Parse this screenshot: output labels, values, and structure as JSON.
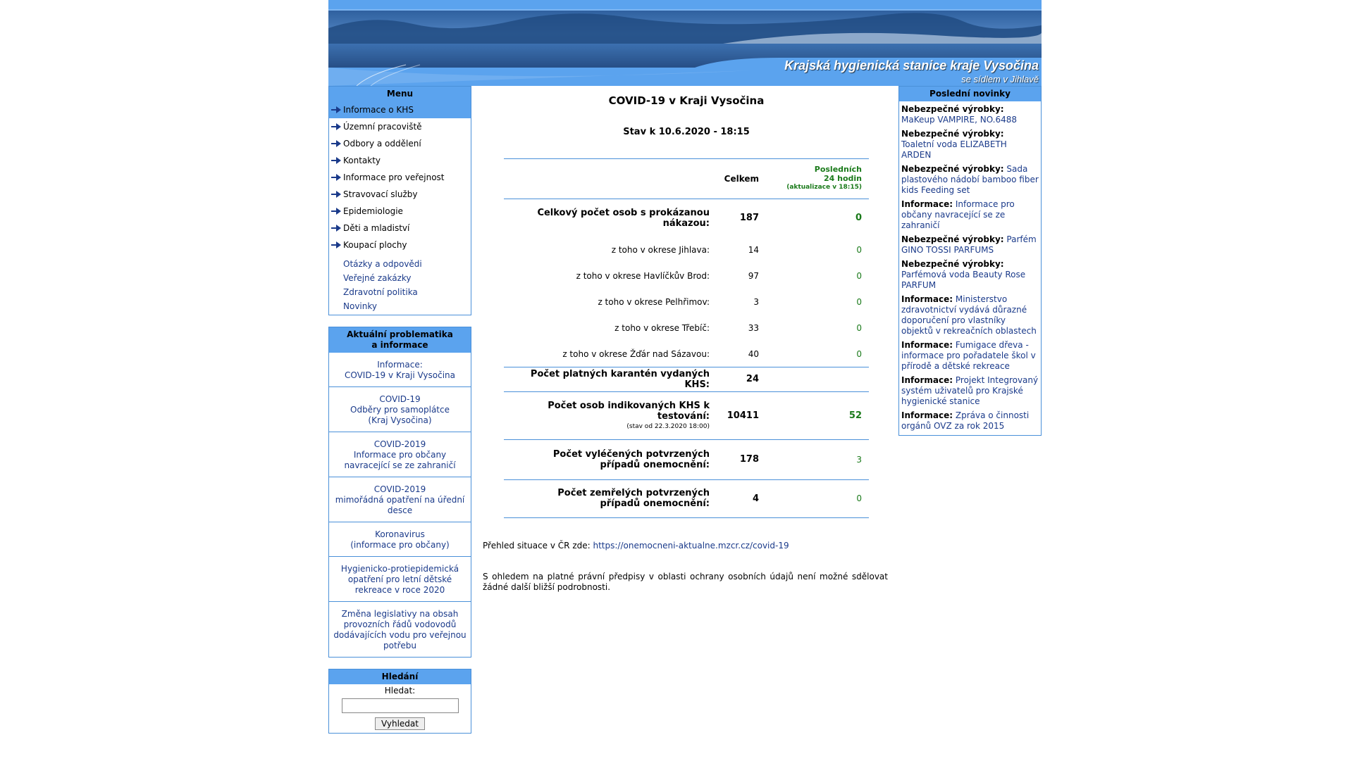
{
  "header": {
    "title": "Krajská hygienická stanice kraje Vysočina",
    "subtitle": "se sídlem v Jihlavě"
  },
  "menu": {
    "heading": "Menu",
    "items": [
      {
        "label": "Informace o KHS",
        "active": true
      },
      {
        "label": "Územní pracoviště"
      },
      {
        "label": "Odbory a oddělení"
      },
      {
        "label": "Kontakty"
      },
      {
        "label": "Informace pro veřejnost"
      },
      {
        "label": "Stravovací služby"
      },
      {
        "label": "Epidemiologie"
      },
      {
        "label": "Děti a mladiství"
      },
      {
        "label": "Koupací plochy"
      }
    ],
    "links": [
      "Otázky a odpovědi",
      "Veřejné zakázky",
      "Zdravotní politika",
      "Novinky"
    ]
  },
  "aktualni": {
    "heading": "Aktuální problematika a informace",
    "items": [
      "Informace:\nCOVID-19 v Kraji Vysočina",
      "COVID-19\nOdběry pro samoplátce\n(Kraj Vysočina)",
      "COVID-2019\nInformace pro občany navracející se ze zahraničí",
      "COVID-2019\nmimořádná opatření na úřední desce",
      "Koronavirus\n(informace pro občany)",
      "Hygienicko-protiepidemická opatření pro letní dětské rekreace v roce 2020",
      "Změna legislativy na obsah provozních řádů vodovodů dodávajících vodu pro veřejnou potřebu"
    ]
  },
  "search": {
    "heading": "Hledání",
    "label": "Hledat:",
    "value": "",
    "button": "Vyhledat"
  },
  "main": {
    "title": "COVID-19 v Kraji Vysočina",
    "stav": "Stav k 10.6.2020 - 18:15",
    "col_total": "Celkem",
    "col_last_line1": "Posledních",
    "col_last_line2": "24 hodin",
    "col_last_note": "(aktualizace v 18:15)",
    "rows": {
      "total_label": "Celkový počet osob s prokázanou nákazou:",
      "total_value": "187",
      "total_last": "0",
      "jihlava_label": "z toho v okrese Jihlava:",
      "jihlava_value": "14",
      "jihlava_last": "0",
      "havl_label": "z toho v okrese Havlíčkův Brod:",
      "havl_value": "97",
      "havl_last": "0",
      "pelh_label": "z toho v okrese Pelhřimov:",
      "pelh_value": "3",
      "pelh_last": "0",
      "treb_label": "z toho v okrese Třebíč:",
      "treb_value": "33",
      "treb_last": "0",
      "zdar_label": "z toho v okrese Žďár nad Sázavou:",
      "zdar_value": "40",
      "zdar_last": "0",
      "kar_label": "Počet platných karantén vydaných KHS:",
      "kar_value": "24",
      "test_label": "Počet osob indikovaných KHS k testování:",
      "test_note": "(stav od 22.3.2020 18:00)",
      "test_value": "10411",
      "test_last": "52",
      "vyl_label": "Počet vyléčených potvrzených případů onemocnění:",
      "vyl_value": "178",
      "vyl_last": "3",
      "zem_label": "Počet zemřelých potvrzených případů onemocnění:",
      "zem_value": "4",
      "zem_last": "0"
    },
    "overview_text": "Přehled situace v ČR zde:",
    "overview_link": "https://onemocneni-aktualne.mzcr.cz/covid-19",
    "disclaimer": "S ohledem na platné právní předpisy v oblasti ochrany osobních údajů není možné sdělovat žádné další bližší podrobnosti."
  },
  "news": {
    "heading": "Poslední novinky",
    "items": [
      {
        "type": "Nebezpečné výrobky:",
        "text": "MaKeup VAMPIRE, NO.6488"
      },
      {
        "type": "Nebezpečné výrobky:",
        "text": "Toaletní voda ELIZABETH ARDEN"
      },
      {
        "type": "Nebezpečné výrobky:",
        "text": "Sada plastového nádobí bamboo fiber kids Feeding set"
      },
      {
        "type": "Informace:",
        "text": "Informace pro občany navracející se ze zahraničí"
      },
      {
        "type": "Nebezpečné výrobky:",
        "text": "Parfém GINO TOSSI PARFUMS"
      },
      {
        "type": "Nebezpečné výrobky:",
        "text": "Parfémová voda Beauty Rose PARFUM"
      },
      {
        "type": "Informace:",
        "text": "Ministerstvo zdravotnictví vydává důrazné doporučení pro vlastníky objektů v rekreačních oblastech"
      },
      {
        "type": "Informace:",
        "text": "Fumigace dřeva - informace pro pořadatele škol v přírodě a dětské rekreace"
      },
      {
        "type": "Informace:",
        "text": "Projekt Integrovaný systém uživatelů pro Krajské hygienické stanice"
      },
      {
        "type": "Informace:",
        "text": "Zpráva o činnosti orgánů OVZ za rok 2015"
      }
    ]
  },
  "colors": {
    "accent": "#5ba3ee",
    "border": "#4a90d9",
    "link": "#1a3a8a",
    "green": "#1a7a1a"
  }
}
